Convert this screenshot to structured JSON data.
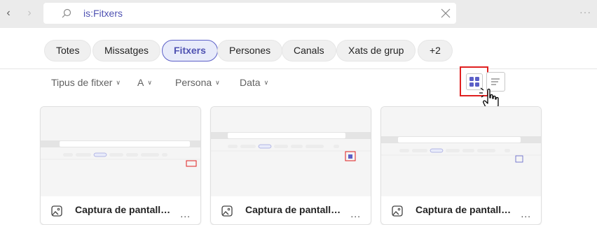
{
  "nav": {
    "back_glyph": "‹",
    "forward_glyph": "›"
  },
  "search": {
    "value": "is:Fitxers",
    "placeholder": "",
    "icon": "search-icon",
    "clear_icon": "close-icon"
  },
  "window": {
    "more_glyph": "···"
  },
  "chips": [
    {
      "label": "Totes",
      "active": false
    },
    {
      "label": "Missatges",
      "active": false
    },
    {
      "label": "Fitxers",
      "active": true
    },
    {
      "label": "Persones",
      "active": false
    },
    {
      "label": "Canals",
      "active": false
    },
    {
      "label": "Xats de grup",
      "active": false
    },
    {
      "label": "+2",
      "active": false
    }
  ],
  "filters": [
    {
      "label": "Tipus de fitxer"
    },
    {
      "label": "A"
    },
    {
      "label": "Persona"
    },
    {
      "label": "Data"
    }
  ],
  "view": {
    "selected": "grid",
    "grid_icon": "grid-view-icon",
    "list_icon": "list-view-icon",
    "highlight_color": "#e02020"
  },
  "cards": [
    {
      "title": "Captura de pantalla ...",
      "icon": "image-file-icon",
      "more": "..."
    },
    {
      "title": "Captura de pantalla ...",
      "icon": "image-file-icon",
      "more": "..."
    },
    {
      "title": "Captura de pantalla ...",
      "icon": "image-file-icon",
      "more": "..."
    }
  ],
  "colors": {
    "accent": "#5b5fc7",
    "accent_text": "#4f52b2",
    "topbar": "#ebebeb"
  }
}
